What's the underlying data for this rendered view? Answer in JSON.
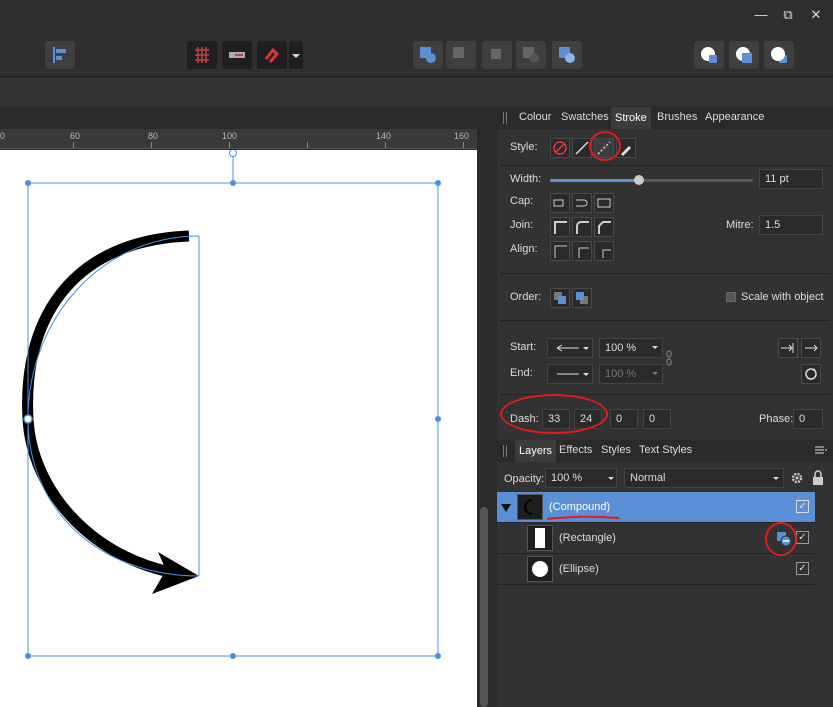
{
  "window": {
    "close": "✕",
    "restore": "⧉",
    "minimize": "—"
  },
  "ruler": {
    "labels": [
      "0",
      "60",
      "80",
      "100",
      "140",
      "160"
    ]
  },
  "stroke_panel": {
    "tabs": [
      "Colour",
      "Swatches",
      "Stroke",
      "Brushes",
      "Appearance"
    ],
    "active_tab": "Stroke",
    "style_label": "Style:",
    "width_label": "Width:",
    "width_value": "11 pt",
    "width_fraction": 0.44,
    "cap_label": "Cap:",
    "join_label": "Join:",
    "mitre_label": "Mitre:",
    "mitre_value": "1.5",
    "align_label": "Align:",
    "order_label": "Order:",
    "scale_label": "Scale with object",
    "start_label": "Start:",
    "start_scale": "100 %",
    "end_label": "End:",
    "end_scale": "100 %",
    "dash_label": "Dash:",
    "dash_values": [
      "33",
      "24",
      "0",
      "0"
    ],
    "phase_label": "Phase:",
    "phase_value": "0"
  },
  "layers_panel": {
    "tabs": [
      "Layers",
      "Effects",
      "Styles",
      "Text Styles"
    ],
    "active_tab": "Layers",
    "opacity_label": "Opacity:",
    "opacity_value": "100 %",
    "blend_mode": "Normal",
    "rows": [
      {
        "name": "(Compound)",
        "selected": true,
        "checked": true
      },
      {
        "name": "(Rectangle)",
        "selected": false,
        "checked": true
      },
      {
        "name": "(Ellipse)",
        "selected": false,
        "checked": true
      }
    ]
  },
  "colors": {
    "accent": "#5b8fd6",
    "selection": "#4a90e2",
    "annotation": "#e21b1b"
  }
}
